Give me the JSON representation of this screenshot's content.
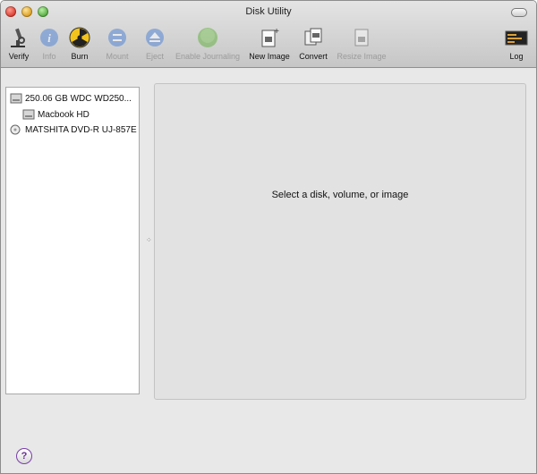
{
  "window": {
    "title": "Disk Utility"
  },
  "toolbar": {
    "items": [
      {
        "label": "Verify",
        "icon": "microscope-icon",
        "enabled": true
      },
      {
        "label": "Info",
        "icon": "info-icon",
        "enabled": false
      },
      {
        "label": "Burn",
        "icon": "burn-radiation-icon",
        "enabled": true
      },
      {
        "label": "Mount",
        "icon": "mount-icon",
        "enabled": false
      },
      {
        "label": "Eject",
        "icon": "eject-icon",
        "enabled": false
      },
      {
        "label": "Enable Journaling",
        "icon": "journaling-icon",
        "enabled": false
      },
      {
        "label": "New Image",
        "icon": "new-image-icon",
        "enabled": true
      },
      {
        "label": "Convert",
        "icon": "convert-icon",
        "enabled": true
      },
      {
        "label": "Resize Image",
        "icon": "resize-image-icon",
        "enabled": false
      },
      {
        "label": "Log",
        "icon": "log-icon",
        "enabled": true
      }
    ]
  },
  "sidebar": {
    "items": [
      {
        "label": "250.06 GB WDC WD250...",
        "icon": "hard-drive-icon"
      },
      {
        "label": "Macbook HD",
        "icon": "volume-icon"
      },
      {
        "label": "MATSHITA DVD-R UJ-857E",
        "icon": "optical-drive-icon"
      }
    ]
  },
  "main": {
    "placeholder": "Select a disk, volume, or image"
  },
  "help": {
    "label": "?"
  }
}
